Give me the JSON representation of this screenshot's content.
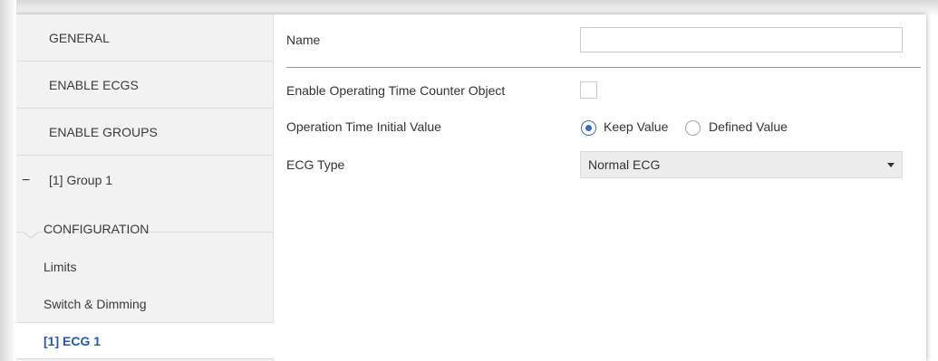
{
  "sidebar": {
    "items": [
      {
        "label": "GENERAL"
      },
      {
        "label": "ENABLE ECGS"
      },
      {
        "label": "ENABLE GROUPS"
      },
      {
        "label": "[1] Group 1",
        "expander": "−"
      },
      {
        "label": "CONFIGURATION"
      },
      {
        "label": "Limits"
      },
      {
        "label": "Switch & Dimming"
      },
      {
        "label": "[1] ECG 1",
        "active": true
      }
    ]
  },
  "form": {
    "name_label": "Name",
    "name_value": "",
    "counter_label": "Enable Operating Time Counter Object",
    "counter_checked": false,
    "initial_label": "Operation Time Initial Value",
    "initial_options": [
      "Keep Value",
      "Defined Value"
    ],
    "initial_selected": "Keep Value",
    "ecg_type_label": "ECG Type",
    "ecg_type_value": "Normal ECG"
  },
  "colors": {
    "active_text": "#1f5ba8",
    "sidebar_bg": "#f2f2f2",
    "radio_accent": "#3a6db3"
  },
  "icons": {
    "expander": "minus-icon",
    "dropdown": "chevron-down-icon"
  }
}
